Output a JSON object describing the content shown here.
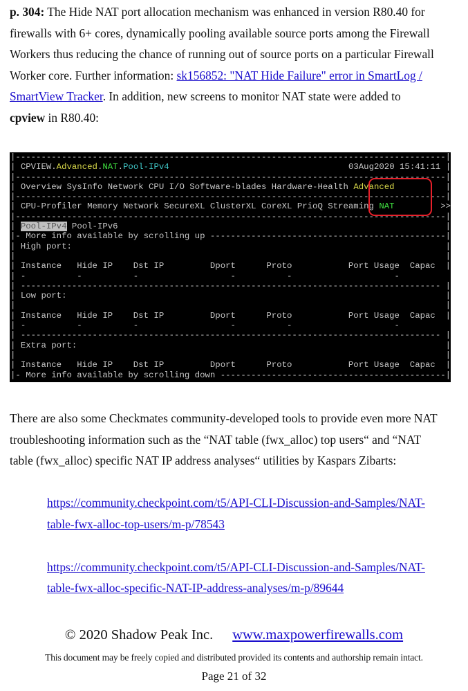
{
  "para1": {
    "l1_bold": "p. 304:",
    "l1": " The Hide NAT port allocation mechanism was enhanced in version R80.40 for",
    "l2": "firewalls with 6+ cores, dynamically pooling available source ports among the Firewall",
    "l3": "Workers thus reducing the chance of running out of source ports on a particular Firewall",
    "l4": "Worker core.  Further information: ",
    "l4_link": "sk156852: \"NAT Hide Failure\" error in SmartLog /",
    "l5_link": "SmartView Tracker",
    "l5": ".  In addition, new screens to monitor NAT state were added to",
    "l6_bold": "cpview",
    "l6": " in R80.40:"
  },
  "terminal": {
    "width_chars": 86,
    "colors": {
      "text": "#c8c8c8",
      "yellow": "#d8d84a",
      "green": "#40e040",
      "cyan": "#40c8c8",
      "highlight": "#e8202a"
    },
    "lines": [
      {
        "segs": [
          [
            "|",
            ""
          ]
        ],
        "fill": "-",
        "right": "|"
      },
      {
        "segs": [
          [
            "| CPVIEW.",
            ""
          ],
          [
            "Advanced",
            "yellow"
          ],
          [
            ".",
            ""
          ],
          [
            "NAT",
            "green"
          ],
          [
            ".",
            ""
          ],
          [
            "Pool-IPv4",
            "cyan"
          ]
        ],
        "fill": " ",
        "right": "03Aug2020 15:41:11 |"
      },
      {
        "segs": [
          [
            "|",
            ""
          ]
        ],
        "fill": "-",
        "right": "|"
      },
      {
        "segs": [
          [
            "| Overview SysInfo Network CPU I/O Software-blades Hardware-Health ",
            ""
          ],
          [
            "Advanced",
            "yellow"
          ]
        ],
        "fill": " ",
        "right": "|"
      },
      {
        "segs": [
          [
            "|",
            ""
          ]
        ],
        "fill": "-",
        "right": "|"
      },
      {
        "segs": [
          [
            "| CPU-Profiler Memory Network SecureXL ClusterXL CoreXL PrioQ Streaming ",
            ""
          ],
          [
            "NAT",
            "green"
          ]
        ],
        "fill": " ",
        "right": ">>"
      },
      {
        "segs": [
          [
            "|",
            ""
          ]
        ],
        "fill": "-",
        "right": "|"
      },
      {
        "segs": [
          [
            "| ",
            ""
          ],
          [
            "Pool-IPv4",
            "sel"
          ],
          [
            " Pool-IPv6",
            ""
          ]
        ],
        "fill": " ",
        "right": "|"
      },
      {
        "segs": [
          [
            "|- More info available by scrolling up ",
            ""
          ]
        ],
        "fill": "-",
        "right": "|"
      },
      {
        "segs": [
          [
            "| High port:",
            ""
          ]
        ],
        "fill": " ",
        "right": "|"
      },
      {
        "segs": [
          [
            "|",
            ""
          ]
        ],
        "fill": " ",
        "right": "|"
      },
      {
        "segs": [
          [
            "| Instance   Hide IP    Dst IP         Dport      Proto           Port Usage  Capac",
            ""
          ]
        ],
        "fill": " ",
        "right": "|"
      },
      {
        "segs": [
          [
            "| -          -          -                  -          -                    -",
            ""
          ]
        ],
        "fill": " ",
        "right": ""
      },
      {
        "segs": [
          [
            "| ",
            ""
          ]
        ],
        "fill": "-",
        "right": " |"
      },
      {
        "segs": [
          [
            "| Low port:",
            ""
          ]
        ],
        "fill": " ",
        "right": "|"
      },
      {
        "segs": [
          [
            "|",
            ""
          ]
        ],
        "fill": " ",
        "right": "|"
      },
      {
        "segs": [
          [
            "| Instance   Hide IP    Dst IP         Dport      Proto           Port Usage  Capac",
            ""
          ]
        ],
        "fill": " ",
        "right": "|"
      },
      {
        "segs": [
          [
            "| -          -          -                  -          -                    -",
            ""
          ]
        ],
        "fill": " ",
        "right": ""
      },
      {
        "segs": [
          [
            "| ",
            ""
          ]
        ],
        "fill": "-",
        "right": " |"
      },
      {
        "segs": [
          [
            "| Extra port:",
            ""
          ]
        ],
        "fill": " ",
        "right": "|"
      },
      {
        "segs": [
          [
            "|",
            ""
          ]
        ],
        "fill": " ",
        "right": "|"
      },
      {
        "segs": [
          [
            "| Instance   Hide IP    Dst IP         Dport      Proto           Port Usage  Capac",
            ""
          ]
        ],
        "fill": " ",
        "right": "|"
      },
      {
        "segs": [
          [
            "|- More info available by scrolling down ",
            ""
          ]
        ],
        "fill": "-",
        "right": "|"
      }
    ]
  },
  "para2": {
    "l1": "There are also some Checkmates community-developed tools to provide even more NAT",
    "l2": "troubleshooting information such as the “NAT table (fwx_alloc) top users“ and “NAT",
    "l3": "table (fwx_alloc) specific NAT IP address analyses“ utilities by Kaspars Zibarts:"
  },
  "links": {
    "link1_l1": "https://community.checkpoint.com/t5/API-CLI-Discussion-and-Samples/NAT-",
    "link1_l2": "table-fwx-alloc-top-users/m-p/78543",
    "link2_l1": "https://community.checkpoint.com/t5/API-CLI-Discussion-and-Samples/NAT-",
    "link2_l2": "table-fwx-alloc-specific-NAT-IP-address-analyses/m-p/89644"
  },
  "footer": {
    "copyright": "© 2020 Shadow Peak Inc.",
    "website": "www.maxpowerfirewalls.com",
    "notice": "This document may be freely copied and distributed provided its contents and authorship remain intact.",
    "page": "Page 21 of 32"
  }
}
